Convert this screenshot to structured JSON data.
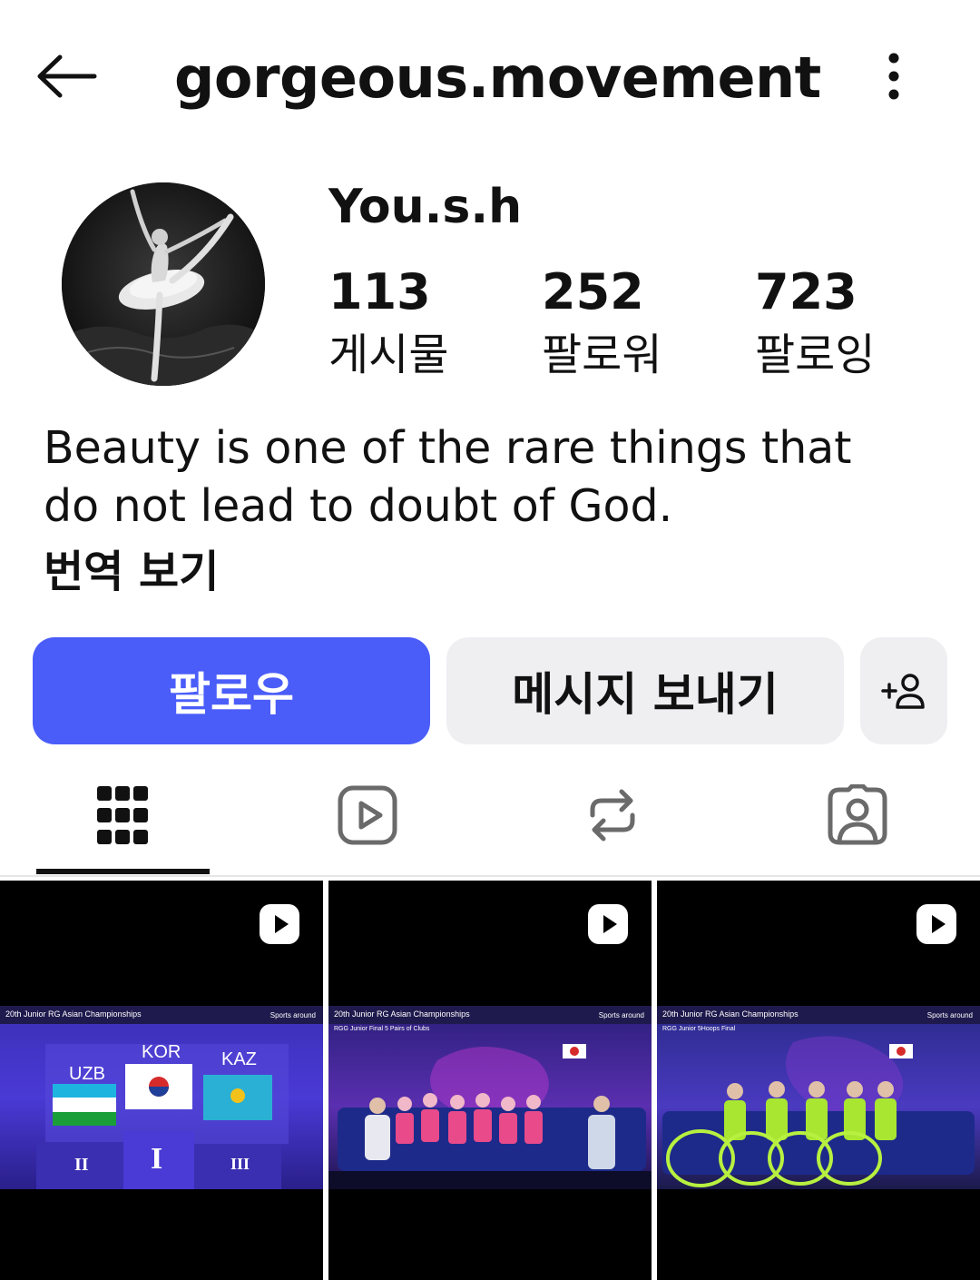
{
  "header": {
    "username": "gorgeous.movement",
    "back_icon": "arrow-left-icon",
    "more_icon": "vertical-dots-icon"
  },
  "profile": {
    "display_name": "You.s.h",
    "avatar": "ballerina-photo",
    "stats": [
      {
        "value": "113",
        "label": "게시물"
      },
      {
        "value": "252",
        "label": "팔로워"
      },
      {
        "value": "723",
        "label": "팔로잉"
      }
    ],
    "bio_line1": "Beauty is one of the rare things that",
    "bio_line2": "do not lead to doubt of God.",
    "translate_label": "번역 보기"
  },
  "actions": {
    "follow_label": "팔로우",
    "message_label": "메시지 보내기",
    "suggest_icon": "add-person-icon",
    "follow_color": "#4a5df9"
  },
  "tabs": [
    {
      "name": "grid",
      "icon": "grid-icon",
      "active": true
    },
    {
      "name": "reels",
      "icon": "reels-icon",
      "active": false
    },
    {
      "name": "reposts",
      "icon": "repost-icon",
      "active": false
    },
    {
      "name": "tagged",
      "icon": "tagged-person-icon",
      "active": false
    }
  ],
  "posts": [
    {
      "caption": "20th Junior RG Asian Championships",
      "brand": "Sports around",
      "countries": [
        "UZB",
        "KOR",
        "KAZ"
      ],
      "ranks": [
        "II",
        "I",
        "III"
      ]
    },
    {
      "caption": "20th Junior RG Asian Championships",
      "subcaption": "RGG Junior Final 5 Pairs of Clubs",
      "brand": "Sports around"
    },
    {
      "caption": "20th Junior RG Asian Championships",
      "subcaption": "RGG Junior 5Hoops Final",
      "brand": "Sports around"
    }
  ]
}
